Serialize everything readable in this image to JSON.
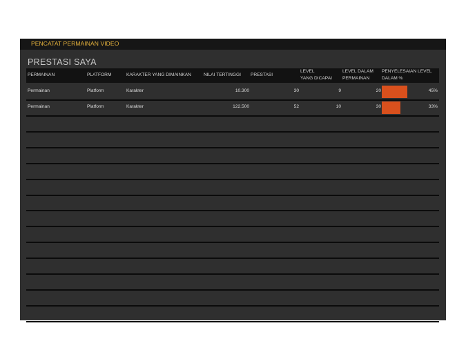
{
  "app": {
    "title": "PENCATAT PERMAINAN VIDEO"
  },
  "section": {
    "title": "PRESTASI SAYA"
  },
  "colors": {
    "accent_title": "#e8b43c",
    "bar": "#d9501d",
    "background": "#2f2f2f",
    "header_bg": "#121212"
  },
  "table": {
    "headers": {
      "game": "PERMAINAN",
      "platform": "PLATFORM",
      "character": "KARAKTER YANG DIMAINKAN",
      "high_score": "NILAI TERTINGGI",
      "achievements": "PRESTASI",
      "levels_reached_1": "LEVEL",
      "levels_reached_2": "YANG DICAPAI",
      "levels_in_game_1": "LEVEL DALAM",
      "levels_in_game_2": "PERMAINAN",
      "completion_1": "PENYELESAIAN LEVEL",
      "completion_2": "DALAM %"
    },
    "rows": [
      {
        "game": "Permainan",
        "platform": "Platform",
        "character": "Karakter",
        "high_score": "10.300",
        "achievements": "30",
        "levels_reached": "9",
        "levels_in_game": "20",
        "completion_label": "45%",
        "completion_fraction": 0.45
      },
      {
        "game": "Permainan",
        "platform": "Platform",
        "character": "Karakter",
        "high_score": "122.500",
        "achievements": "52",
        "levels_reached": "10",
        "levels_in_game": "30",
        "completion_label": "33%",
        "completion_fraction": 0.33
      }
    ],
    "empty_row_count": 13
  }
}
